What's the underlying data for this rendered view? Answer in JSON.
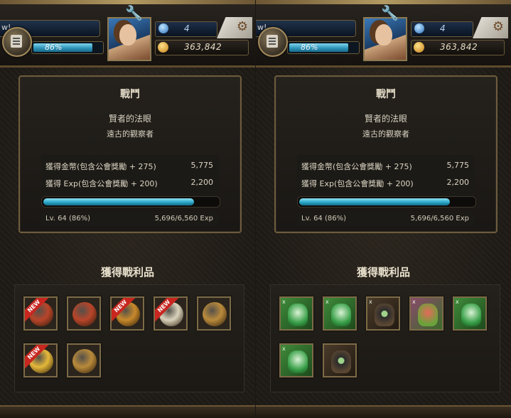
{
  "panels": [
    {
      "player_name": "w!",
      "hp_percent": "86%",
      "hp_fill": 0.86,
      "gems": "4",
      "coins": "363,842",
      "battle": {
        "title": "戰鬥",
        "stage": "賢者的法眼",
        "subtitle": "遠古的觀察者",
        "gold_label": "獲得金幣(包含公會獎勵 + 275)",
        "gold_value": "5,775",
        "exp_label": "獲得 Exp(包含公會獎勵 + 200)",
        "exp_value": "2,200",
        "level": "Lv. 64 (86%)",
        "exp_progress": "5,696/6,560 Exp",
        "exp_fill": 0.868
      },
      "loot_title": "獲得戰利品",
      "loot": [
        {
          "kind": "coin",
          "color": "#b8452a",
          "new": true,
          "new_label": "NEW"
        },
        {
          "kind": "coin",
          "color": "#b8452a",
          "new": false
        },
        {
          "kind": "coin",
          "color": "#c8892b",
          "new": true,
          "new_label": "NEW"
        },
        {
          "kind": "coin",
          "color": "#d9d2bb",
          "new": true,
          "new_label": "NEW"
        },
        {
          "kind": "coin",
          "color": "#b98a3b",
          "new": false
        },
        {
          "kind": "coin",
          "color": "#e5b83a",
          "new": true,
          "new_label": "NEW"
        },
        {
          "kind": "coin",
          "color": "#b98a3b",
          "new": false
        }
      ]
    },
    {
      "player_name": "w!",
      "hp_percent": "86%",
      "hp_fill": 0.86,
      "gems": "4",
      "coins": "363,842",
      "battle": {
        "title": "戰鬥",
        "stage": "賢者的法眼",
        "subtitle": "遠古的觀察者",
        "gold_label": "獲得金幣(包含公會獎勵 + 275)",
        "gold_value": "5,775",
        "exp_label": "獲得 Exp(包含公會獎勵 + 200)",
        "exp_value": "2,200",
        "level": "Lv. 64 (86%)",
        "exp_progress": "5,696/6,560 Exp",
        "exp_fill": 0.868
      },
      "loot_title": "獲得戰利品",
      "loot": [
        {
          "kind": "card",
          "style": "green",
          "tag": "x",
          "icon": "serpent-icon"
        },
        {
          "kind": "card",
          "style": "green",
          "tag": "x",
          "icon": "serpent-icon"
        },
        {
          "kind": "card",
          "style": "dark",
          "tag": "x",
          "icon": "eye-witch-icon"
        },
        {
          "kind": "card",
          "style": "mix",
          "tag": "x",
          "icon": "goblin-icon"
        },
        {
          "kind": "card",
          "style": "green",
          "tag": "x",
          "icon": "eye-witch-icon"
        },
        {
          "kind": "card",
          "style": "green",
          "tag": "x",
          "icon": "plant-icon"
        },
        {
          "kind": "card",
          "style": "dark",
          "tag": "",
          "icon": "eye-witch-icon"
        }
      ]
    }
  ]
}
